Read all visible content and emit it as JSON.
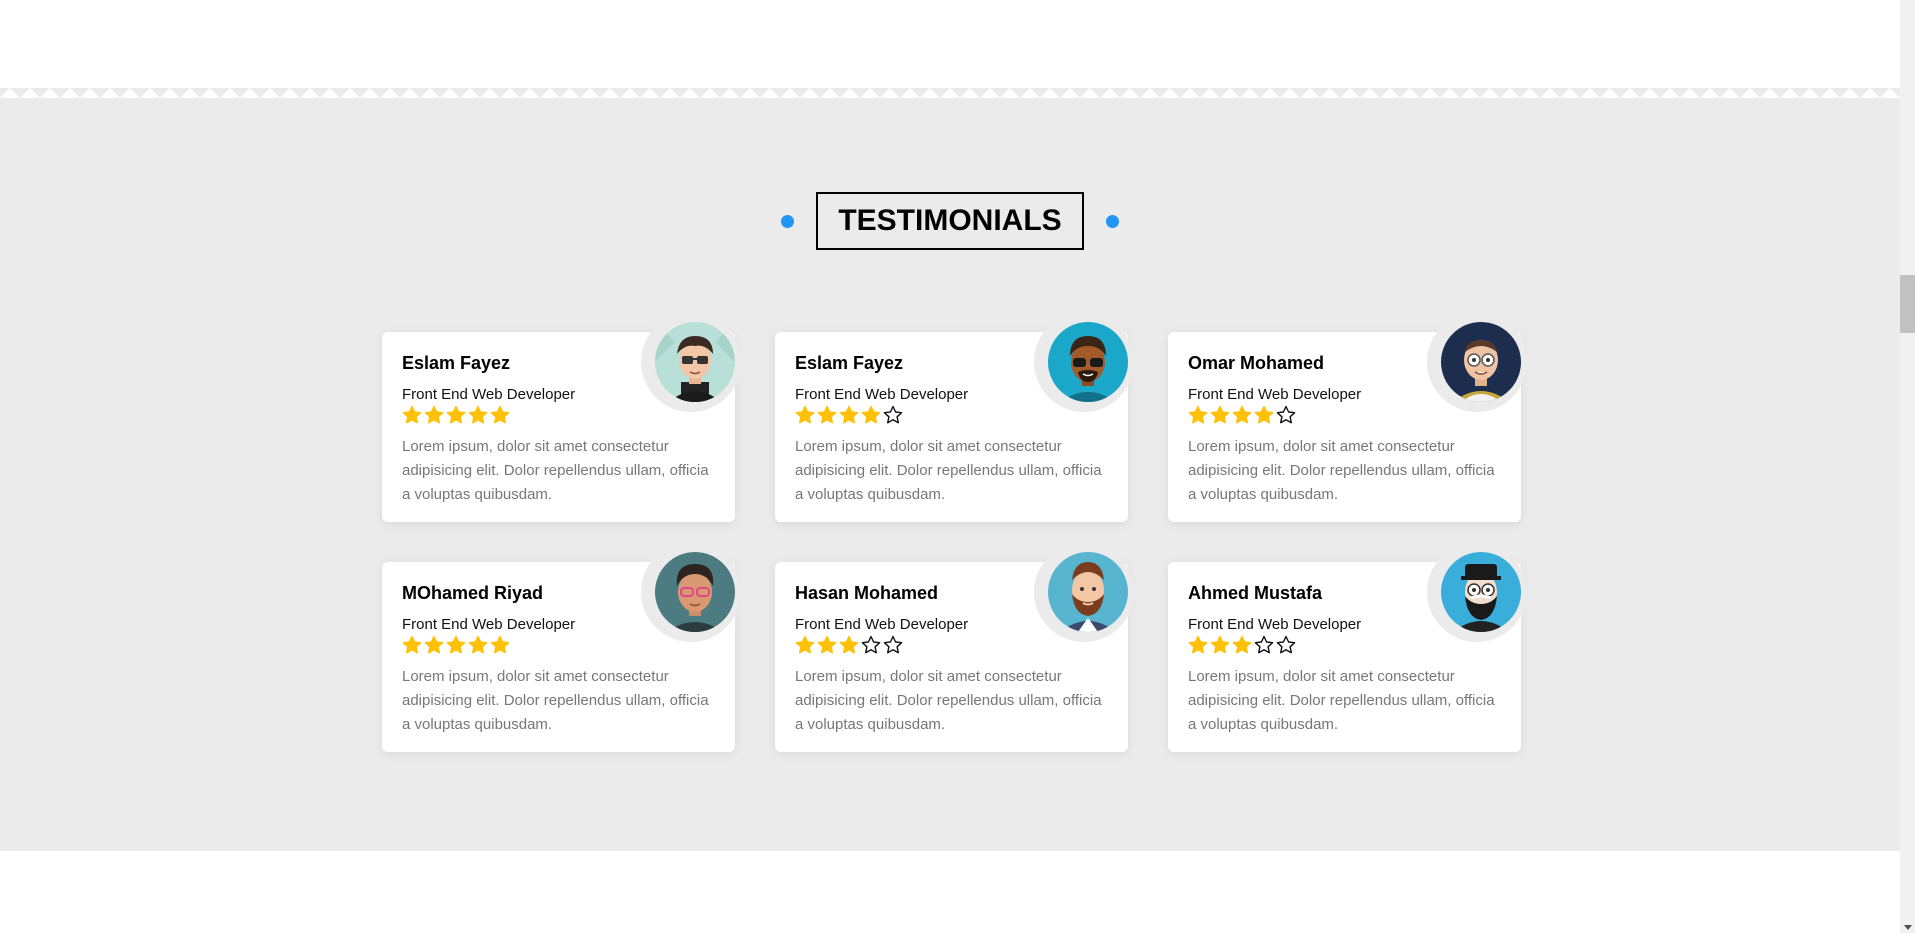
{
  "heading": "TESTIMONIALS",
  "colors": {
    "accent": "#2196f3",
    "star_filled": "#ffc107",
    "section_bg": "#ebebeb"
  },
  "testimonials": [
    {
      "name": "Eslam Fayez",
      "title": "Front End Web Developer",
      "rating": 5,
      "text": "Lorem ipsum, dolor sit amet consectetur adipisicing elit. Dolor repellendus ullam, officia a voluptas quibusdam.",
      "avatar_icon": "avatar-glasses-icon"
    },
    {
      "name": "Eslam Fayez",
      "title": "Front End Web Developer",
      "rating": 4,
      "text": "Lorem ipsum, dolor sit amet consectetur adipisicing elit. Dolor repellendus ullam, officia a voluptas quibusdam.",
      "avatar_icon": "avatar-sunglasses-icon"
    },
    {
      "name": "Omar Mohamed",
      "title": "Front End Web Developer",
      "rating": 4,
      "text": "Lorem ipsum, dolor sit amet consectetur adipisicing elit. Dolor repellendus ullam, officia a voluptas quibusdam.",
      "avatar_icon": "avatar-bald-glasses-icon"
    },
    {
      "name": "MOhamed Riyad",
      "title": "Front End Web Developer",
      "rating": 5,
      "text": "Lorem ipsum, dolor sit amet consectetur adipisicing elit. Dolor repellendus ullam, officia a voluptas quibusdam.",
      "avatar_icon": "avatar-pink-glasses-icon"
    },
    {
      "name": "Hasan Mohamed",
      "title": "Front End Web Developer",
      "rating": 3,
      "text": "Lorem ipsum, dolor sit amet consectetur adipisicing elit. Dolor repellendus ullam, officia a voluptas quibusdam.",
      "avatar_icon": "avatar-beard-icon"
    },
    {
      "name": "Ahmed Mustafa",
      "title": "Front End Web Developer",
      "rating": 3,
      "text": "Lorem ipsum, dolor sit amet consectetur adipisicing elit. Dolor repellendus ullam, officia a voluptas quibusdam.",
      "avatar_icon": "avatar-hat-beard-icon"
    }
  ]
}
